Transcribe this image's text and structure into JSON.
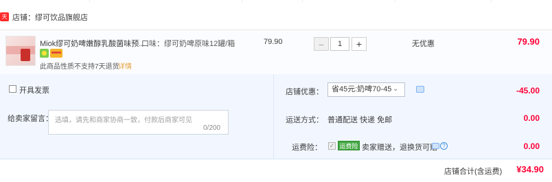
{
  "store": {
    "badge": "天猫",
    "name": "店铺：缪可饮品旗舰店"
  },
  "item": {
    "title": "Miok缪可奶啤嫩醇乳酸菌味预...",
    "spec": "口味：缪可奶啤原味12罐/箱",
    "unit_price": "79.90",
    "quantity": "1",
    "qty_minus": "−",
    "qty_plus": "+",
    "discount": "无优惠",
    "subtotal": "79.90",
    "notice": "此商品性质不支持7天退货",
    "detail_link": "详情"
  },
  "order": {
    "invoice_label": "开具发票",
    "message_label": "给卖家留言：",
    "message_placeholder": "选填，请先和商家协商一致，付款后商家可见",
    "message_count": "0/200",
    "store_discount_label": "店铺优惠：",
    "store_discount_option": "省45元:奶啤70-45",
    "store_discount_value": "-45.00",
    "shipping_label": "运送方式：",
    "shipping_text": "普通配送 快递 免邮",
    "shipping_value": "0.00",
    "insurance_label": "运费险：",
    "insurance_badge": "运费险",
    "insurance_text": "卖家赠送，退换货可赔",
    "insurance_value": "0.00"
  },
  "total": {
    "label": "店铺合计(含运费)",
    "value": "¥34.90"
  }
}
